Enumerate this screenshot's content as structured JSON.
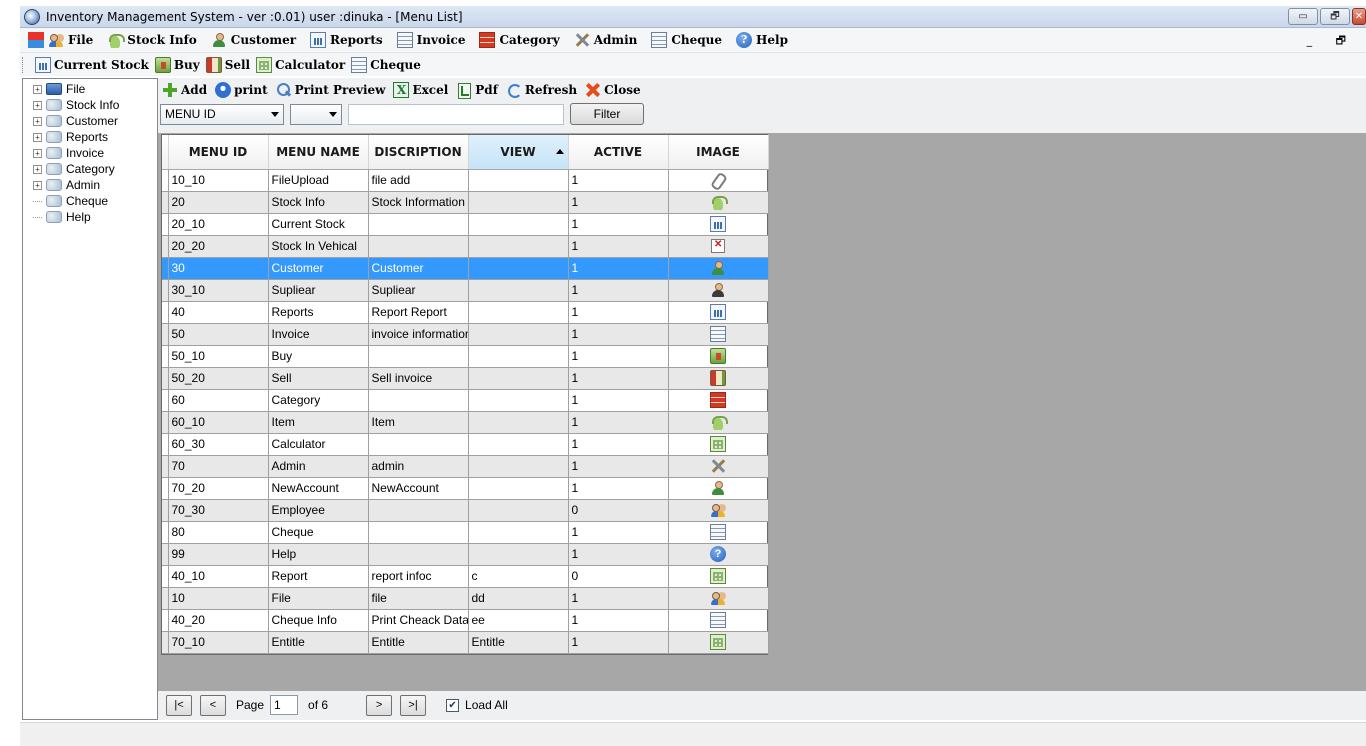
{
  "window": {
    "title": "Inventory Management System - ver :0.01) user :dinuka - [Menu List]",
    "buttons": [
      "▭",
      "🗗",
      "✕"
    ]
  },
  "menubar": {
    "items": [
      {
        "label": "File",
        "icon": "grid-icon"
      },
      {
        "label": "Stock Info",
        "icon": "basket-icon"
      },
      {
        "label": "Customer",
        "icon": "user-icon"
      },
      {
        "label": "Reports",
        "icon": "report-icon"
      },
      {
        "label": "Invoice",
        "icon": "invoice-icon"
      },
      {
        "label": "Category",
        "icon": "brick-icon"
      },
      {
        "label": "Admin",
        "icon": "tools-icon"
      },
      {
        "label": "Cheque",
        "icon": "invoice-icon"
      },
      {
        "label": "Help",
        "icon": "help-icon"
      }
    ],
    "right_controls": "_ 🗗"
  },
  "toolbar": {
    "items": [
      {
        "label": "Current Stock",
        "icon": "report-icon"
      },
      {
        "label": "Buy",
        "icon": "buy-icon"
      },
      {
        "label": "Sell",
        "icon": "sell-icon"
      },
      {
        "label": "Calculator",
        "icon": "calculator-icon"
      },
      {
        "label": "Cheque",
        "icon": "invoice-icon"
      }
    ]
  },
  "tree": {
    "items": [
      {
        "label": "File",
        "expandable": true
      },
      {
        "label": "Stock Info",
        "expandable": true
      },
      {
        "label": "Customer",
        "expandable": true
      },
      {
        "label": "Reports",
        "expandable": true
      },
      {
        "label": "Invoice",
        "expandable": true
      },
      {
        "label": "Category",
        "expandable": true
      },
      {
        "label": "Admin",
        "expandable": true
      },
      {
        "label": "Cheque",
        "expandable": false
      },
      {
        "label": "Help",
        "expandable": false
      }
    ]
  },
  "actions": {
    "add": "Add",
    "print": "print",
    "print_preview": "Print Preview",
    "excel": "Excel",
    "pdf": "Pdf",
    "refresh": "Refresh",
    "close": "Close"
  },
  "filter": {
    "field_select": "MENU ID",
    "operator_select": "",
    "value": "",
    "button": "Filter"
  },
  "grid": {
    "columns": [
      "MENU ID",
      "MENU NAME",
      "DISCRIPTION",
      "VIEW",
      "ACTIVE",
      "IMAGE"
    ],
    "sorted_column": "VIEW",
    "selected_row_index": 4,
    "rows": [
      {
        "id": "10_10",
        "name": "FileUpload",
        "desc": "file add",
        "view": "",
        "active": "1",
        "icon": "paperclip-icon"
      },
      {
        "id": "20",
        "name": "Stock Info",
        "desc": "Stock Information",
        "view": "",
        "active": "1",
        "icon": "basket-icon"
      },
      {
        "id": "20_10",
        "name": "Current Stock",
        "desc": "",
        "view": "",
        "active": "1",
        "icon": "report-icon"
      },
      {
        "id": "20_20",
        "name": "Stock In Vehical",
        "desc": "",
        "view": "",
        "active": "1",
        "icon": "missing-image-icon"
      },
      {
        "id": "30",
        "name": "Customer",
        "desc": "Customer",
        "view": "",
        "active": "1",
        "icon": "user-icon"
      },
      {
        "id": "30_10",
        "name": "Supliear",
        "desc": "Supliear",
        "view": "",
        "active": "1",
        "icon": "user-dark-icon"
      },
      {
        "id": "40",
        "name": "Reports",
        "desc": "Report Report",
        "view": "",
        "active": "1",
        "icon": "report-icon"
      },
      {
        "id": "50",
        "name": "Invoice",
        "desc": "invoice information",
        "view": "",
        "active": "1",
        "icon": "invoice-icon"
      },
      {
        "id": "50_10",
        "name": "Buy",
        "desc": "",
        "view": "",
        "active": "1",
        "icon": "buy-icon"
      },
      {
        "id": "50_20",
        "name": "Sell",
        "desc": "Sell invoice",
        "view": "",
        "active": "1",
        "icon": "sell-icon"
      },
      {
        "id": "60",
        "name": "Category",
        "desc": "",
        "view": "",
        "active": "1",
        "icon": "brick-icon"
      },
      {
        "id": "60_10",
        "name": "Item",
        "desc": "Item",
        "view": "",
        "active": "1",
        "icon": "basket-icon"
      },
      {
        "id": "60_30",
        "name": "Calculator",
        "desc": "",
        "view": "",
        "active": "1",
        "icon": "calculator-icon"
      },
      {
        "id": "70",
        "name": "Admin",
        "desc": "admin",
        "view": "",
        "active": "1",
        "icon": "tools-icon"
      },
      {
        "id": "70_20",
        "name": "NewAccount",
        "desc": "NewAccount",
        "view": "",
        "active": "1",
        "icon": "user-icon"
      },
      {
        "id": "70_30",
        "name": "Employee",
        "desc": "",
        "view": "",
        "active": "0",
        "icon": "group-icon"
      },
      {
        "id": "80",
        "name": "Cheque",
        "desc": "",
        "view": "",
        "active": "1",
        "icon": "invoice-icon"
      },
      {
        "id": "99",
        "name": "Help",
        "desc": "",
        "view": "",
        "active": "1",
        "icon": "help-icon"
      },
      {
        "id": "40_10",
        "name": "Report",
        "desc": "report infoc",
        "view": "c",
        "active": "0",
        "icon": "calculator-icon"
      },
      {
        "id": "10",
        "name": "File",
        "desc": "file",
        "view": "dd",
        "active": "1",
        "icon": "group-icon"
      },
      {
        "id": "40_20",
        "name": "Cheque Info",
        "desc": "Print Cheack Data",
        "view": "ee",
        "active": "1",
        "icon": "invoice-icon"
      },
      {
        "id": "70_10",
        "name": "Entitle",
        "desc": "Entitle",
        "view": "Entitle",
        "active": "1",
        "icon": "calculator-icon"
      }
    ]
  },
  "pager": {
    "first": "|<",
    "prev": "<",
    "page_label": "Page",
    "page_value": "1",
    "of_label": "of 6",
    "next": ">",
    "last": ">|",
    "load_all_label": "Load All",
    "load_all_checked": true
  },
  "colors": {
    "selected_row": "#3399ff",
    "grid_background": "#a7a7a7",
    "alt_row": "#e8e8e8"
  }
}
